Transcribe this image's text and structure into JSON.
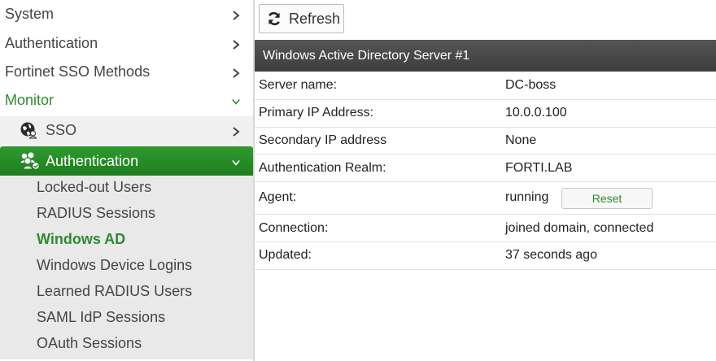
{
  "sidebar": {
    "items": [
      {
        "label": "System"
      },
      {
        "label": "Authentication"
      },
      {
        "label": "Fortinet SSO Methods"
      },
      {
        "label": "Monitor"
      }
    ],
    "sso": {
      "label": "SSO"
    },
    "authentication": {
      "label": "Authentication"
    },
    "submenu": [
      {
        "label": "Locked-out Users"
      },
      {
        "label": "RADIUS Sessions"
      },
      {
        "label": "Windows AD"
      },
      {
        "label": "Windows Device Logins"
      },
      {
        "label": "Learned RADIUS Users"
      },
      {
        "label": "SAML IdP Sessions"
      },
      {
        "label": "OAuth Sessions"
      }
    ],
    "active_item": "Windows AD"
  },
  "toolbar": {
    "refresh_label": "Refresh"
  },
  "panel": {
    "title": "Windows Active Directory Server #1",
    "rows": [
      {
        "key": "Server name:",
        "value": "DC-boss"
      },
      {
        "key": "Primary IP Address:",
        "value": "10.0.0.100"
      },
      {
        "key": "Secondary IP address",
        "value": "None"
      },
      {
        "key": "Authentication Realm:",
        "value": "FORTI.LAB"
      },
      {
        "key": "Agent:",
        "value": "running",
        "button": "Reset"
      },
      {
        "key": "Connection:",
        "value": "joined domain, connected"
      },
      {
        "key": "Updated:",
        "value": "37 seconds ago"
      }
    ]
  },
  "colors": {
    "accent_green": "#2f8a2f",
    "header_dark": "#454545",
    "submenu_bg": "#e9e9e9"
  }
}
